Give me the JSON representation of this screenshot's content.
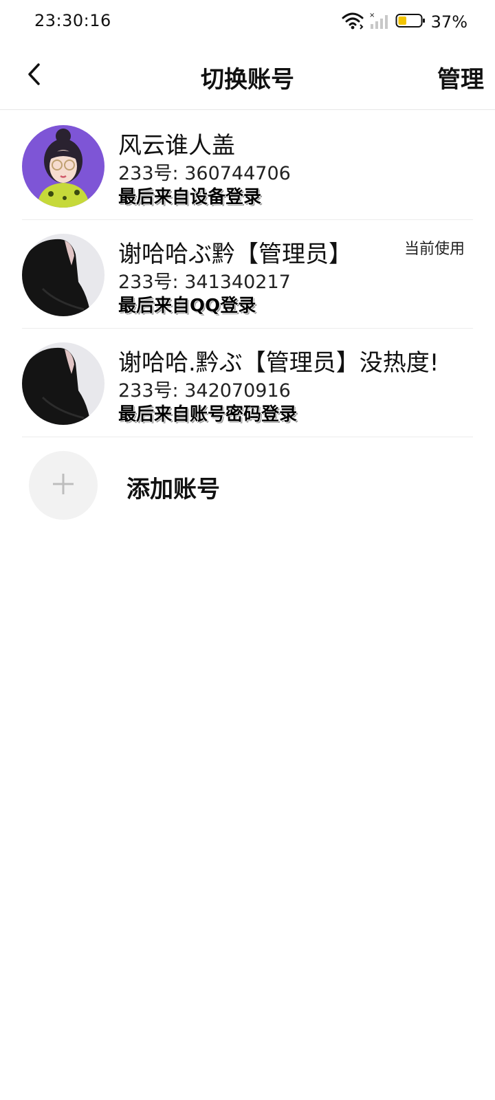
{
  "status_bar": {
    "time": "23:30:16",
    "battery_percent": "37%",
    "battery_level": 0.37,
    "icons": [
      "wifi-icon",
      "signal-icon",
      "battery-icon"
    ],
    "battery_color": "#f2c400"
  },
  "nav": {
    "title": "切换账号",
    "manage_label": "管理",
    "back_icon": "chevron-left-icon"
  },
  "accounts": [
    {
      "name": "风云谁人盖",
      "id_line": "233号: 360744706",
      "login_info": "最后来自设备登录",
      "badge": "",
      "avatar_color": "#7e55d6"
    },
    {
      "name": "谢哈哈ぶ黔【管理员】",
      "id_line": "233号: 341340217",
      "login_info": "最后来自QQ登录",
      "badge": "当前使用",
      "avatar_color": "#e8e8ec"
    },
    {
      "name": "谢哈哈.黔ぶ【管理员】没热度!",
      "id_line": "233号: 342070916",
      "login_info": "最后来自账号密码登录",
      "badge": "",
      "avatar_color": "#e8e8ec"
    }
  ],
  "add_account": {
    "label": "添加账号",
    "icon": "plus-icon"
  }
}
